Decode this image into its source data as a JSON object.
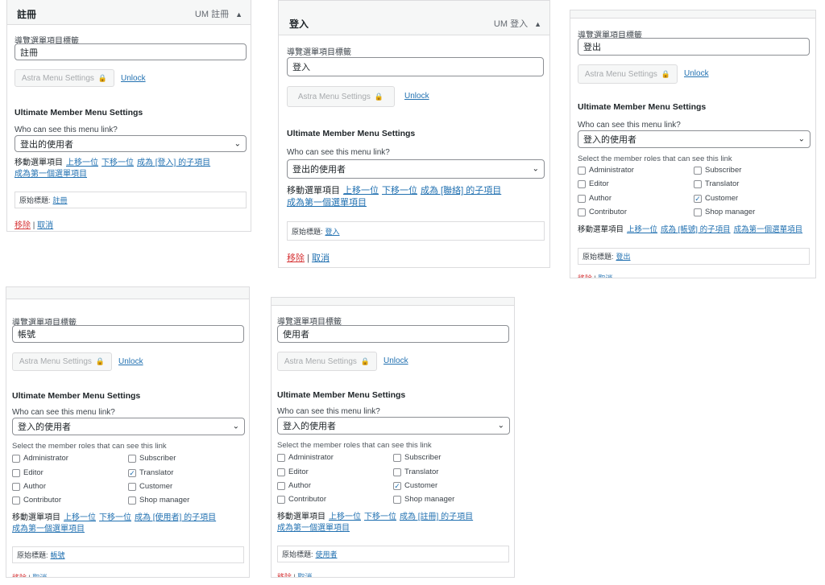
{
  "common": {
    "nav_label_caption": "導覽選單項目標籤",
    "astra_button": "Astra Menu Settings",
    "unlock": "Unlock",
    "um_settings_title": "Ultimate Member Menu Settings",
    "who_can_see": "Who can see this menu link?",
    "roles_caption": "Select the member roles that can see this link",
    "move_label": "移動選單項目",
    "move_up": "上移一位",
    "move_down": "下移一位",
    "original_title_label": "原始標題:",
    "remove": "移除",
    "separator": "|",
    "cancel": "取消",
    "role_names": [
      "Administrator",
      "Subscriber",
      "Editor",
      "Translator",
      "Author",
      "Customer",
      "Contributor",
      "Shop manager"
    ]
  },
  "panels": [
    {
      "header_title": "註冊",
      "header_right": "UM 註冊",
      "header_arrow": "▲",
      "label_value": "註冊",
      "who_value": "登出的使用者",
      "roles_checked": [],
      "move_child": "成為 [登入] 的子項目",
      "move_first": "成為第一個選單項目",
      "original_title": "註冊"
    },
    {
      "header_title": "登入",
      "header_right": "UM 登入",
      "header_arrow": "▲",
      "label_value": "登入",
      "who_value": "登出的使用者",
      "roles_checked": [],
      "move_child": "成為 [聯絡] 的子項目",
      "move_first": "成為第一個選單項目",
      "original_title": "登入"
    },
    {
      "header_title": "",
      "header_right": "",
      "header_arrow": "",
      "label_value": "登出",
      "who_value": "登入的使用者",
      "roles_checked": [
        "Customer"
      ],
      "move_child": "成為 [帳號] 的子項目",
      "move_first": "成為第一個選單項目",
      "original_title": "登出"
    },
    {
      "header_title": "",
      "header_right": "",
      "header_arrow": "",
      "label_value": "帳號",
      "who_value": "登入的使用者",
      "roles_checked": [
        "Translator"
      ],
      "move_child": "成為 [使用者] 的子項目",
      "move_first": "成為第一個選單項目",
      "original_title": "帳號"
    },
    {
      "header_title": "",
      "header_right": "",
      "header_arrow": "",
      "label_value": "使用者",
      "who_value": "登入的使用者",
      "roles_checked": [
        "Customer"
      ],
      "move_child": "成為 [註冊] 的子項目",
      "move_first": "成為第一個選單項目",
      "original_title": "使用者"
    }
  ]
}
